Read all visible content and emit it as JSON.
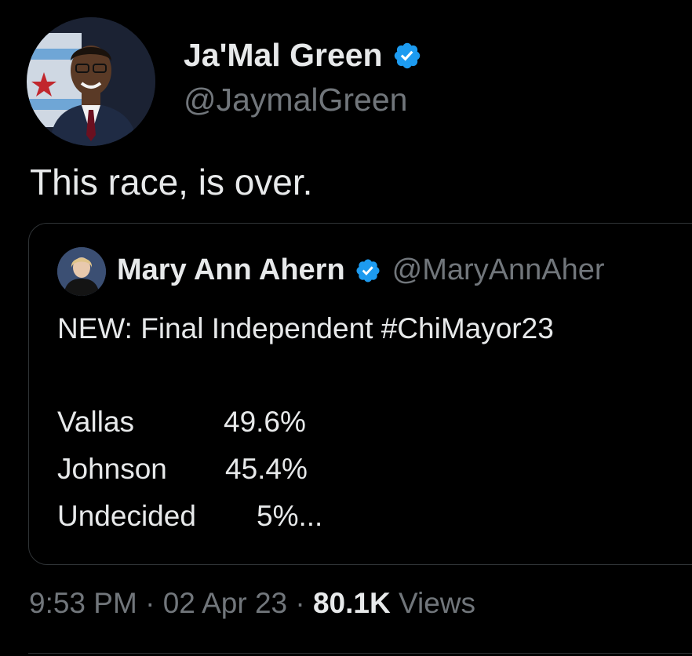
{
  "author": {
    "name": "Ja'Mal Green",
    "handle": "@JaymalGreen",
    "verified_icon": "verified-badge-icon",
    "avatar_icon": "profile-photo"
  },
  "tweet": {
    "text": "This race, is over."
  },
  "quoted": {
    "name": "Mary Ann Ahern",
    "handle": "@MaryAnnAher",
    "verified_icon": "verified-badge-icon",
    "text": "NEW:  Final Independent #ChiMayor23",
    "rows": [
      {
        "label": "Vallas",
        "value": "49.6%"
      },
      {
        "label": "Johnson",
        "value": "45.4%"
      },
      {
        "label": "Undecided",
        "value": "5%..."
      }
    ]
  },
  "meta": {
    "time": "9:53 PM",
    "sep1": "·",
    "date": "02 Apr 23",
    "sep2": "·",
    "views_count": "80.1K",
    "views_label": "Views"
  },
  "colors": {
    "background": "#000000",
    "text_primary": "#e7e9ea",
    "text_secondary": "#71767b",
    "verified": "#1d9bf0",
    "border": "#2f3336"
  }
}
